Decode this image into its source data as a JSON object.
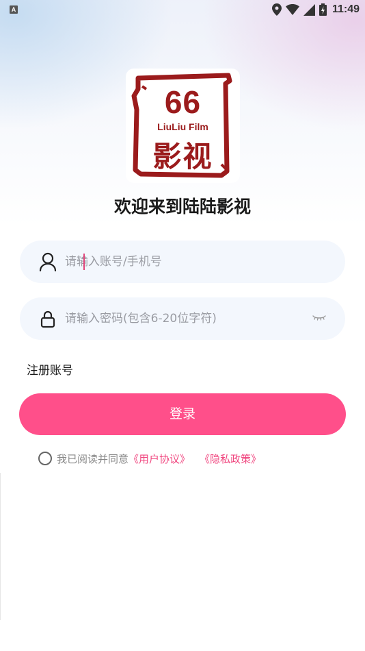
{
  "status_bar": {
    "badge": "A",
    "time": "11:49"
  },
  "logo": {
    "number": "66",
    "english": "LiuLiu Film",
    "chinese": "影视",
    "color": "#9b1b1c"
  },
  "welcome_title": "欢迎来到陆陆影视",
  "account_field": {
    "placeholder": "请输入账号/手机号",
    "value": ""
  },
  "password_field": {
    "placeholder": "请输入密码(包含6-20位字符)",
    "value": ""
  },
  "register_link": "注册账号",
  "login_button": "登录",
  "agreement": {
    "prefix": "我已阅读并同意",
    "user_agreement": "《用户协议》",
    "privacy_policy": "《隐私政策》",
    "checked": false
  },
  "colors": {
    "accent": "#ff4f8a",
    "link": "#f0467f",
    "field_bg": "#f3f7fd"
  }
}
